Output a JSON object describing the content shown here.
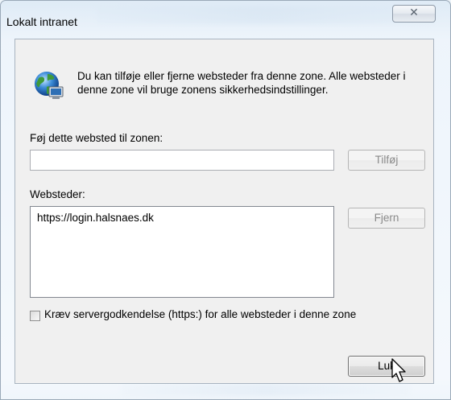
{
  "window": {
    "title": "Lokalt intranet",
    "close_label": "✕"
  },
  "description": "Du kan tilføje eller fjerne websteder fra denne zone. Alle websteder i denne zone vil bruge zonens sikkerhedsindstillinger.",
  "add_section": {
    "label": "Føj dette websted til zonen:",
    "input_value": "",
    "add_button": "Tilføj"
  },
  "sites_section": {
    "label": "Websteder:",
    "items": [
      "https://login.halsnaes.dk"
    ],
    "remove_button": "Fjern"
  },
  "https_checkbox": {
    "label": "Kræv servergodkendelse (https:) for alle websteder i denne zone",
    "checked": false
  },
  "close_button": "Luk",
  "icons": {
    "zone": "globe-computer-icon",
    "cursor": "mouse-cursor-icon"
  }
}
